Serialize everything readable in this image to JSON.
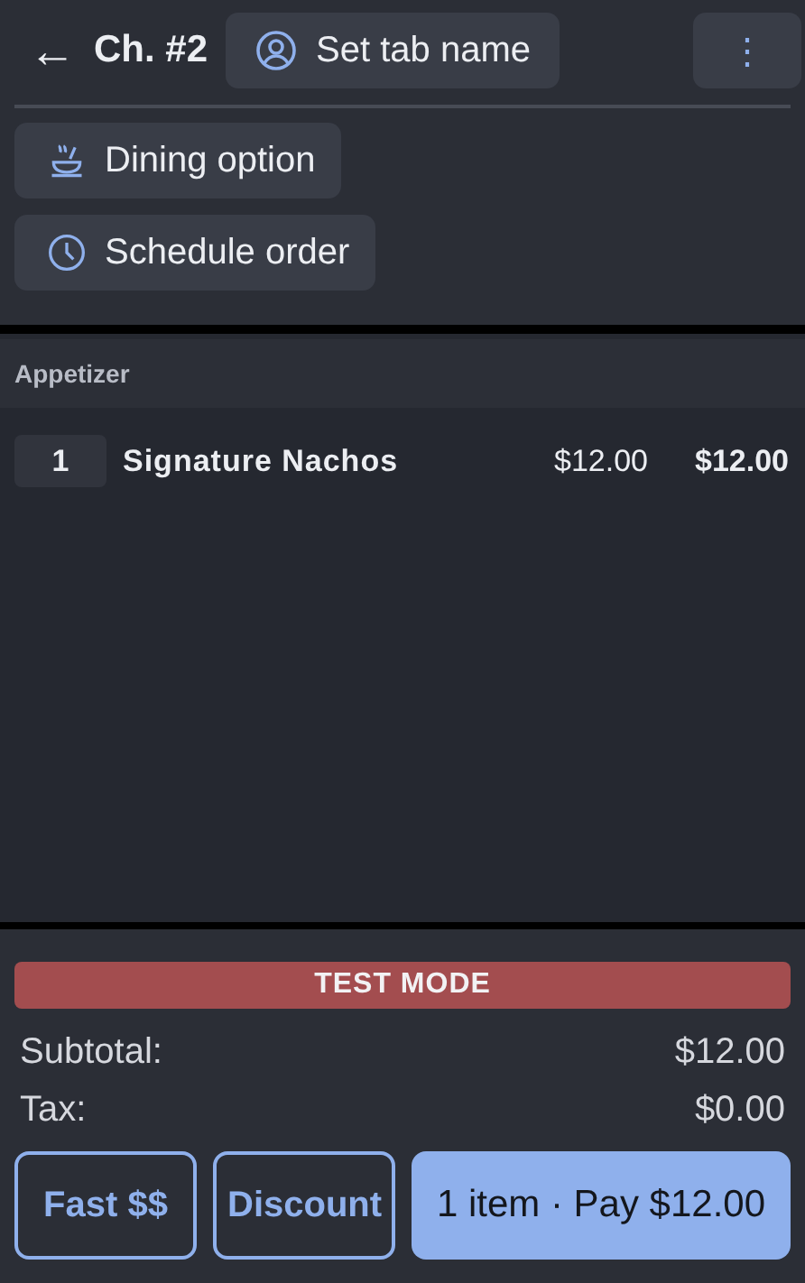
{
  "header": {
    "back": "←",
    "title": "Ch. #2",
    "tab_name_button": "Set tab name",
    "more": "⋮"
  },
  "options": [
    {
      "label": "Dining option"
    },
    {
      "label": "Schedule order"
    }
  ],
  "sections": [
    {
      "name": "Appetizer",
      "items": [
        {
          "qty": "1",
          "name": "Signature Nachos",
          "price": "$12.00",
          "total": "$12.00"
        }
      ]
    }
  ],
  "banner": "TEST MODE",
  "totals": [
    {
      "label": "Subtotal:",
      "value": "$12.00"
    },
    {
      "label": "Tax:",
      "value": "$0.00"
    }
  ],
  "actions": [
    {
      "label": "Fast $$",
      "kind": "outline"
    },
    {
      "label": "Discount",
      "kind": "outline"
    },
    {
      "label": "1 item · Pay $12.00",
      "kind": "primary"
    }
  ]
}
